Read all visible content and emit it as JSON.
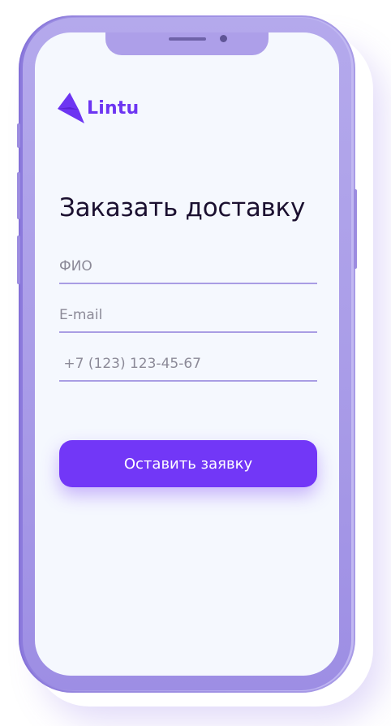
{
  "brand": {
    "name": "Lintu",
    "accent_color": "#7237f7",
    "logo_icon": "lintu-bird-logo-icon"
  },
  "form": {
    "title": "Заказать доставку",
    "fields": [
      {
        "placeholder": "ФИО",
        "type": "text"
      },
      {
        "placeholder": "E-mail",
        "type": "email"
      },
      {
        "placeholder": " +7 (123) 123-45-67",
        "type": "tel"
      }
    ],
    "submit_label": "Оставить заявку"
  }
}
